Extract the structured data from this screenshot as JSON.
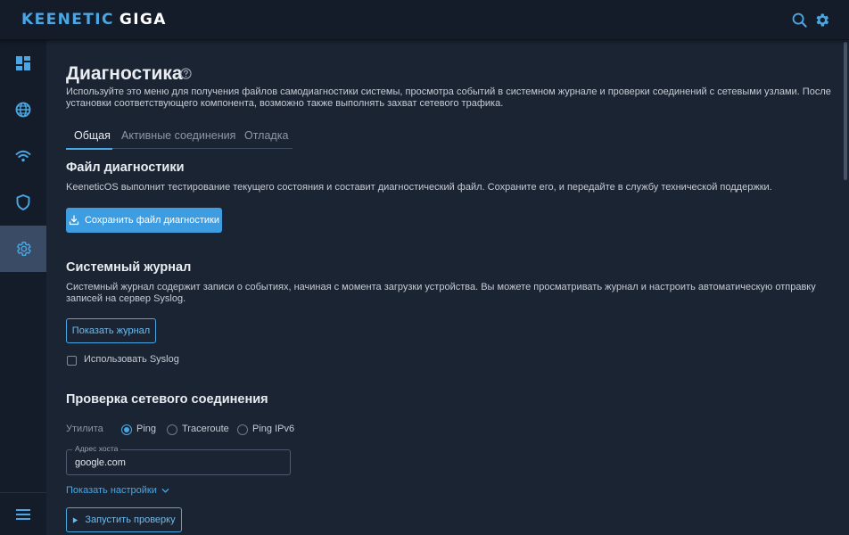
{
  "header": {
    "brand": "KEENETIC",
    "model": "GIGA",
    "icons": [
      "search-icon",
      "gear-icon"
    ]
  },
  "sidebar": {
    "items": [
      {
        "name": "dashboard",
        "icon": "dashboard-icon",
        "active": false
      },
      {
        "name": "internet",
        "icon": "globe-icon",
        "active": false
      },
      {
        "name": "wifi",
        "icon": "wifi-icon",
        "active": false
      },
      {
        "name": "security",
        "icon": "shield-icon",
        "active": false
      },
      {
        "name": "system",
        "icon": "gear-icon",
        "active": true
      }
    ],
    "menu_icon": "menu-icon"
  },
  "page": {
    "title": "Диагностика",
    "description": "Используйте это меню для получения файлов самодиагностики системы, просмотра событий в системном журнале и проверки соединений с сетевыми узлами. После установки соответствующего компонента, возможно также выполнять захват сетевого трафика."
  },
  "tabs": [
    {
      "label": "Общая",
      "active": true
    },
    {
      "label": "Активные соединения",
      "active": false
    },
    {
      "label": "Отладка",
      "active": false
    }
  ],
  "diag_file": {
    "title": "Файл диагностики",
    "text": "KeeneticOS выполнит тестирование текущего состояния и составит диагностический файл. Сохраните его, и передайте в службу технической поддержки.",
    "button": "Сохранить файл диагностики"
  },
  "syslog": {
    "title": "Системный журнал",
    "text": "Системный журнал содержит записи о событиях, начиная с момента загрузки устройства. Вы можете просматривать журнал и настроить автоматическую отправку записей на сервер Syslog.",
    "button": "Показать журнал",
    "checkbox_label": "Использовать Syslog",
    "checkbox_checked": false
  },
  "network_check": {
    "title": "Проверка сетевого соединения",
    "utility_label": "Утилита",
    "options": [
      {
        "label": "Ping",
        "checked": true
      },
      {
        "label": "Traceroute",
        "checked": false
      },
      {
        "label": "Ping IPv6",
        "checked": false
      }
    ],
    "host_label": "Адрес хоста",
    "host_value": "google.com",
    "settings_link": "Показать настройки",
    "run_button": "Запустить проверку"
  },
  "colors": {
    "accent": "#4aa7e3",
    "background": "#1b2433",
    "sidebar": "#141c29",
    "active_item": "#3a4b66"
  }
}
